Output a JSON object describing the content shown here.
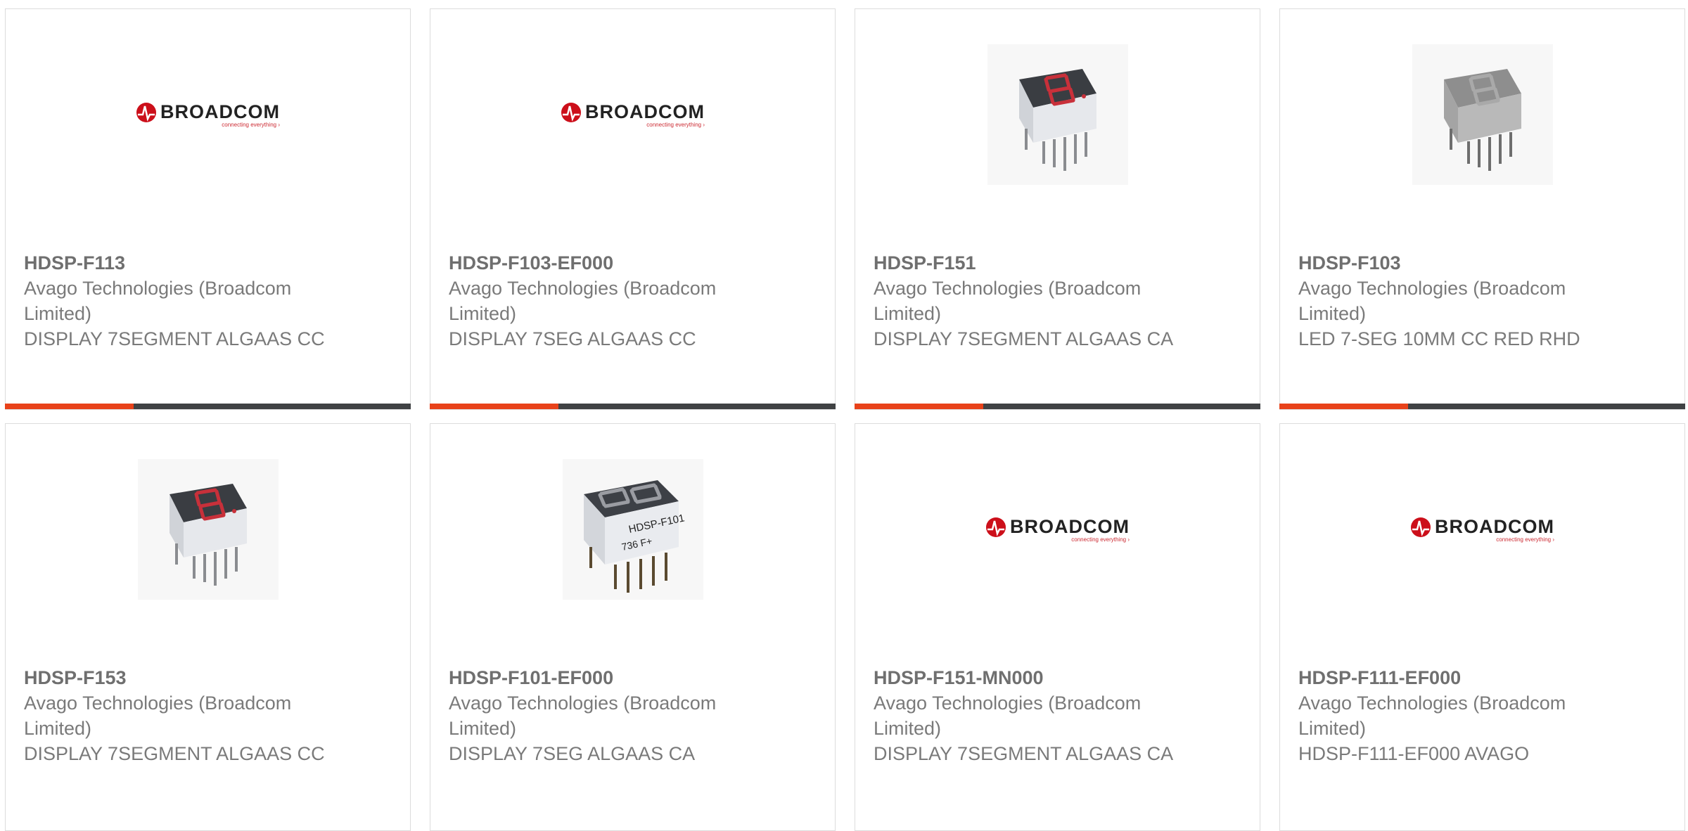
{
  "brand": {
    "logo_word": "BROADCOM",
    "logo_mark": "®",
    "tagline": "connecting everything ›",
    "accent_color": "#e8421a",
    "logo_red": "#cc0f1a"
  },
  "products": [
    {
      "part": "HDSP-F113",
      "manufacturer": "Avago Technologies (Broadcom Limited)",
      "description": "DISPLAY 7SEGMENT ALGAAS CC",
      "image": "broadcom-logo"
    },
    {
      "part": "HDSP-F103-EF000",
      "manufacturer": "Avago Technologies (Broadcom Limited)",
      "description": "DISPLAY 7SEG ALGAAS CC",
      "image": "broadcom-logo"
    },
    {
      "part": "HDSP-F151",
      "manufacturer": "Avago Technologies (Broadcom Limited)",
      "description": "DISPLAY 7SEGMENT ALGAAS CA",
      "image": "led-display-red"
    },
    {
      "part": "HDSP-F103",
      "manufacturer": "Avago Technologies (Broadcom Limited)",
      "description": "LED 7-SEG 10MM CC RED RHD",
      "image": "led-display-gray"
    },
    {
      "part": "HDSP-F153",
      "manufacturer": "Avago Technologies (Broadcom Limited)",
      "description": "DISPLAY 7SEGMENT ALGAAS CC",
      "image": "led-display-red"
    },
    {
      "part": "HDSP-F101-EF000",
      "manufacturer": "Avago Technologies (Broadcom Limited)",
      "description": "DISPLAY 7SEG ALGAAS CA",
      "image": "led-display-labeled",
      "image_label": "HDSP-F101",
      "image_code": "736 F+"
    },
    {
      "part": "HDSP-F151-MN000",
      "manufacturer": "Avago Technologies (Broadcom Limited)",
      "description": "DISPLAY 7SEGMENT ALGAAS CA",
      "image": "broadcom-logo"
    },
    {
      "part": "HDSP-F111-EF000",
      "manufacturer": "Avago Technologies (Broadcom Limited)",
      "description": "HDSP-F111-EF000 AVAGO",
      "image": "broadcom-logo"
    }
  ]
}
